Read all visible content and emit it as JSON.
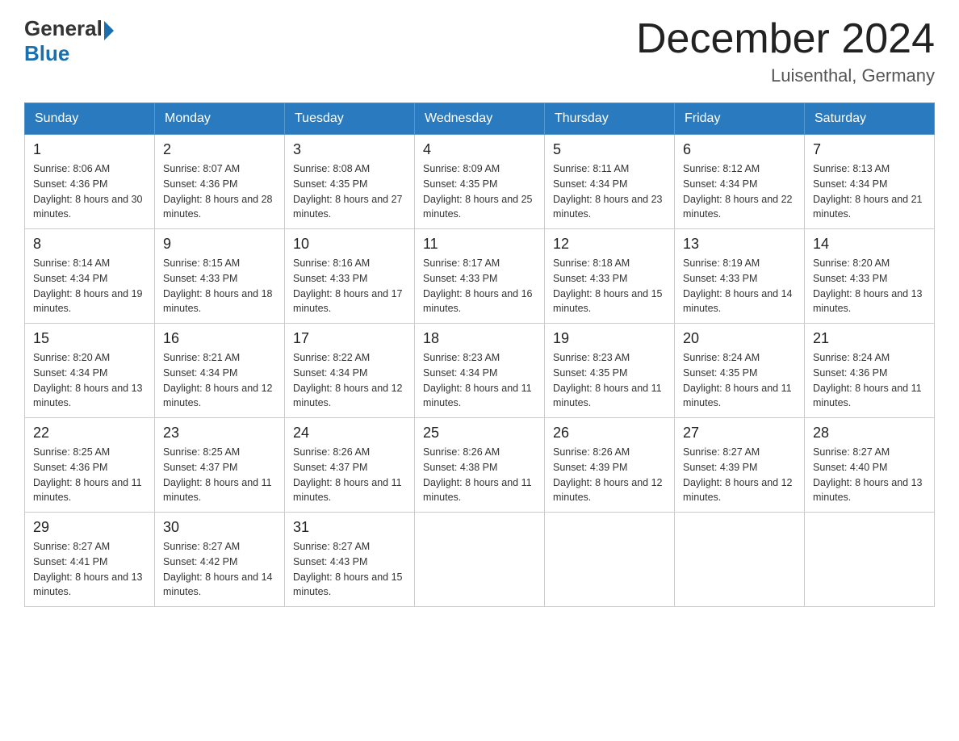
{
  "header": {
    "logo_general": "General",
    "logo_blue": "Blue",
    "month_title": "December 2024",
    "location": "Luisenthal, Germany"
  },
  "weekdays": [
    "Sunday",
    "Monday",
    "Tuesday",
    "Wednesday",
    "Thursday",
    "Friday",
    "Saturday"
  ],
  "weeks": [
    [
      {
        "day": "1",
        "sunrise": "8:06 AM",
        "sunset": "4:36 PM",
        "daylight": "8 hours and 30 minutes."
      },
      {
        "day": "2",
        "sunrise": "8:07 AM",
        "sunset": "4:36 PM",
        "daylight": "8 hours and 28 minutes."
      },
      {
        "day": "3",
        "sunrise": "8:08 AM",
        "sunset": "4:35 PM",
        "daylight": "8 hours and 27 minutes."
      },
      {
        "day": "4",
        "sunrise": "8:09 AM",
        "sunset": "4:35 PM",
        "daylight": "8 hours and 25 minutes."
      },
      {
        "day": "5",
        "sunrise": "8:11 AM",
        "sunset": "4:34 PM",
        "daylight": "8 hours and 23 minutes."
      },
      {
        "day": "6",
        "sunrise": "8:12 AM",
        "sunset": "4:34 PM",
        "daylight": "8 hours and 22 minutes."
      },
      {
        "day": "7",
        "sunrise": "8:13 AM",
        "sunset": "4:34 PM",
        "daylight": "8 hours and 21 minutes."
      }
    ],
    [
      {
        "day": "8",
        "sunrise": "8:14 AM",
        "sunset": "4:34 PM",
        "daylight": "8 hours and 19 minutes."
      },
      {
        "day": "9",
        "sunrise": "8:15 AM",
        "sunset": "4:33 PM",
        "daylight": "8 hours and 18 minutes."
      },
      {
        "day": "10",
        "sunrise": "8:16 AM",
        "sunset": "4:33 PM",
        "daylight": "8 hours and 17 minutes."
      },
      {
        "day": "11",
        "sunrise": "8:17 AM",
        "sunset": "4:33 PM",
        "daylight": "8 hours and 16 minutes."
      },
      {
        "day": "12",
        "sunrise": "8:18 AM",
        "sunset": "4:33 PM",
        "daylight": "8 hours and 15 minutes."
      },
      {
        "day": "13",
        "sunrise": "8:19 AM",
        "sunset": "4:33 PM",
        "daylight": "8 hours and 14 minutes."
      },
      {
        "day": "14",
        "sunrise": "8:20 AM",
        "sunset": "4:33 PM",
        "daylight": "8 hours and 13 minutes."
      }
    ],
    [
      {
        "day": "15",
        "sunrise": "8:20 AM",
        "sunset": "4:34 PM",
        "daylight": "8 hours and 13 minutes."
      },
      {
        "day": "16",
        "sunrise": "8:21 AM",
        "sunset": "4:34 PM",
        "daylight": "8 hours and 12 minutes."
      },
      {
        "day": "17",
        "sunrise": "8:22 AM",
        "sunset": "4:34 PM",
        "daylight": "8 hours and 12 minutes."
      },
      {
        "day": "18",
        "sunrise": "8:23 AM",
        "sunset": "4:34 PM",
        "daylight": "8 hours and 11 minutes."
      },
      {
        "day": "19",
        "sunrise": "8:23 AM",
        "sunset": "4:35 PM",
        "daylight": "8 hours and 11 minutes."
      },
      {
        "day": "20",
        "sunrise": "8:24 AM",
        "sunset": "4:35 PM",
        "daylight": "8 hours and 11 minutes."
      },
      {
        "day": "21",
        "sunrise": "8:24 AM",
        "sunset": "4:36 PM",
        "daylight": "8 hours and 11 minutes."
      }
    ],
    [
      {
        "day": "22",
        "sunrise": "8:25 AM",
        "sunset": "4:36 PM",
        "daylight": "8 hours and 11 minutes."
      },
      {
        "day": "23",
        "sunrise": "8:25 AM",
        "sunset": "4:37 PM",
        "daylight": "8 hours and 11 minutes."
      },
      {
        "day": "24",
        "sunrise": "8:26 AM",
        "sunset": "4:37 PM",
        "daylight": "8 hours and 11 minutes."
      },
      {
        "day": "25",
        "sunrise": "8:26 AM",
        "sunset": "4:38 PM",
        "daylight": "8 hours and 11 minutes."
      },
      {
        "day": "26",
        "sunrise": "8:26 AM",
        "sunset": "4:39 PM",
        "daylight": "8 hours and 12 minutes."
      },
      {
        "day": "27",
        "sunrise": "8:27 AM",
        "sunset": "4:39 PM",
        "daylight": "8 hours and 12 minutes."
      },
      {
        "day": "28",
        "sunrise": "8:27 AM",
        "sunset": "4:40 PM",
        "daylight": "8 hours and 13 minutes."
      }
    ],
    [
      {
        "day": "29",
        "sunrise": "8:27 AM",
        "sunset": "4:41 PM",
        "daylight": "8 hours and 13 minutes."
      },
      {
        "day": "30",
        "sunrise": "8:27 AM",
        "sunset": "4:42 PM",
        "daylight": "8 hours and 14 minutes."
      },
      {
        "day": "31",
        "sunrise": "8:27 AM",
        "sunset": "4:43 PM",
        "daylight": "8 hours and 15 minutes."
      },
      null,
      null,
      null,
      null
    ]
  ],
  "labels": {
    "sunrise": "Sunrise:",
    "sunset": "Sunset:",
    "daylight": "Daylight:"
  }
}
